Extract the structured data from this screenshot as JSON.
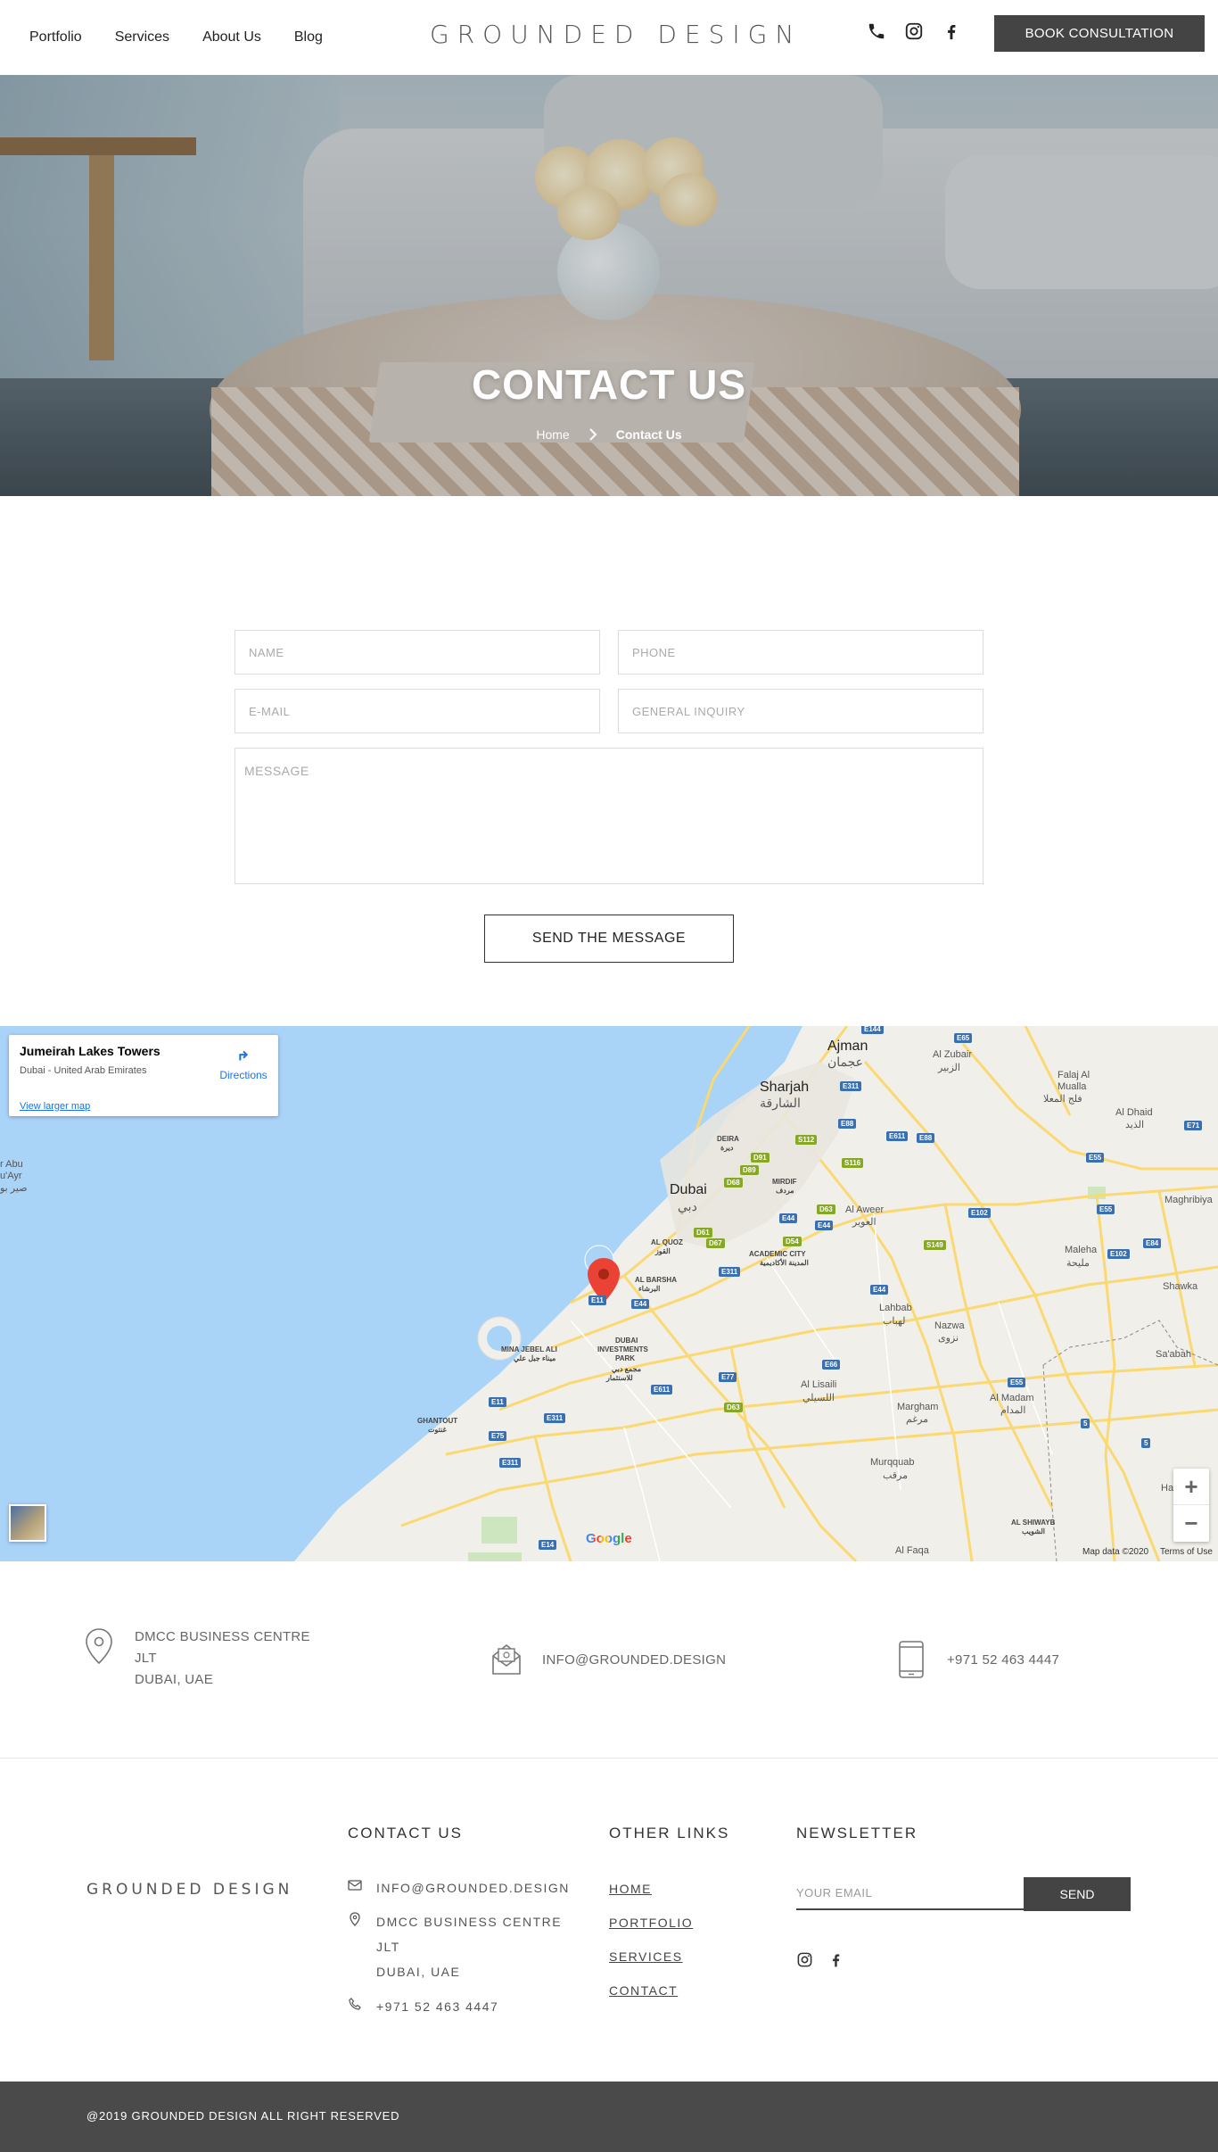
{
  "header": {
    "nav": [
      "Portfolio",
      "Services",
      "About Us",
      "Blog"
    ],
    "logo": "GROUNDED DESIGN",
    "book_label": "BOOK CONSULTATION"
  },
  "hero": {
    "title": "CONTACT US",
    "breadcrumb_home": "Home",
    "breadcrumb_current": "Contact Us"
  },
  "form": {
    "name_placeholder": "NAME",
    "phone_placeholder": "PHONE",
    "email_placeholder": "E-MAIL",
    "inquiry_placeholder": "GENERAL INQUIRY",
    "message_placeholder": "MESSAGE",
    "send_label": "SEND THE MESSAGE"
  },
  "map": {
    "place_title": "Jumeirah Lakes Towers",
    "place_sub": "Dubai - United Arab Emirates",
    "view_larger": "View larger map",
    "directions": "Directions",
    "zoom_in": "+",
    "zoom_out": "−",
    "google": "Google",
    "map_data": "Map data ©2020",
    "terms": "Terms of Use",
    "labels": {
      "ajman": "Ajman",
      "ajman_ar": "عجمان",
      "sharjah": "Sharjah",
      "sharjah_ar": "الشارقة",
      "dubai": "Dubai",
      "dubai_ar": "دبي",
      "al_zubair": "Al Zubair",
      "al_zubair_ar": "الزبير",
      "falaj": "Falaj Al",
      "falaj2": "Mualla",
      "falaj_ar": "فلج المعلا",
      "al_dhaid": "Al Dhaid",
      "al_dhaid_ar": "الذيد",
      "maghribiya": "Maghribiya",
      "maleha": "Maleha",
      "maleha_ar": "مليحة",
      "shawka": "Shawka",
      "saabah": "Sa'abah",
      "al_aweer": "Al Aweer",
      "al_aweer_ar": "العوير",
      "lahbab": "Lahbab",
      "lahbab_ar": "لهباب",
      "nazwa": "Nazwa",
      "nazwa_ar": "نزوى",
      "al_lisaili": "Al Lisaili",
      "al_lisaili_ar": "اللسيلي",
      "margham": "Margham",
      "margham_ar": "مرغم",
      "al_madam": "Al Madam",
      "al_madam_ar": "المدام",
      "murqquab": "Murqquab",
      "murqquab_ar": "مرقب",
      "al_faqa": "Al Faqa",
      "al_shiwayb": "AL SHIWAYB",
      "al_shiwayb_ar": "الشويب",
      "deira": "DEIRA",
      "deira_ar": "ديرة",
      "mirdif": "MIRDIF",
      "mirdif_ar": "مردف",
      "al_quoz": "AL QUOZ",
      "al_quoz_ar": "القوز",
      "academic_city": "ACADEMIC CITY",
      "academic_city_ar": "المدينة الأكاديمية",
      "al_barsha": "AL BARSHA",
      "al_barsha_ar": "البرشاء",
      "dubai_investments": "DUBAI",
      "dubai_investments2": "INVESTMENTS",
      "dubai_investments3": "PARK",
      "dubai_investments_ar": "مجمع دبي",
      "dubai_investments_ar2": "للاستثمار",
      "mina_jebel": "MINA JEBEL ALI",
      "mina_jebel_ar": "ميناء جبل علي",
      "ghantout": "GHANTOUT",
      "ghantout_ar": "غنتوت",
      "abu_ayr": "r Abu",
      "abu_ayr2": "u'Ayr",
      "abu_ayr_ar": "صير بو",
      "ha": "Ha"
    },
    "shields": {
      "e311a": "E311",
      "e311b": "E311",
      "e311c": "E311",
      "e311d": "E311",
      "e11a": "E11",
      "e11b": "E11",
      "e44a": "E44",
      "e44b": "E44",
      "e44c": "E44",
      "e44d": "E44",
      "e77": "E77",
      "e611a": "E611",
      "e611b": "E611",
      "e66": "E66",
      "e55a": "E55",
      "e55b": "E55",
      "e55c": "E55",
      "e102a": "E102",
      "e102b": "E102",
      "e88a": "E88",
      "e88b": "E88",
      "e84": "E84",
      "e75": "E75",
      "e14": "E14",
      "e5a": "5",
      "e5b": "5",
      "d91": "D91",
      "d89": "D89",
      "d68": "D68",
      "d63a": "D63",
      "d63b": "D63",
      "d61": "D61",
      "d67": "D67",
      "d54": "D54",
      "s112": "S112",
      "s116": "S116",
      "s149": "S149",
      "e65": "E65",
      "e71": "E71",
      "e144": "E144"
    }
  },
  "contact_strip": {
    "address": [
      "DMCC BUSINESS CENTRE",
      "JLT",
      "DUBAI, UAE"
    ],
    "email": "INFO@GROUNDED.DESIGN",
    "phone": "+971 52 463 4447"
  },
  "footer": {
    "logo": "GROUNDED DESIGN",
    "contact_heading": "CONTACT US",
    "email": "INFO@GROUNDED.DESIGN",
    "address": [
      "DMCC BUSINESS CENTRE",
      "JLT",
      "DUBAI, UAE"
    ],
    "phone": "+971 52 463 4447",
    "links_heading": "OTHER LINKS",
    "links": [
      "HOME",
      "PORTFOLIO",
      "SERVICES",
      "CONTACT"
    ],
    "newsletter_heading": "NEWSLETTER",
    "newsletter_placeholder": "YOUR EMAIL",
    "newsletter_send": "SEND",
    "copyright": "@2019 GROUNDED DESIGN ALL RIGHT RESERVED"
  },
  "colors": {
    "dark_button": "#444444",
    "bottom_bar": "#4a4a4a",
    "water": "#aad3f8",
    "land": "#f0efea",
    "road": "#fbd972",
    "pin": "#ea4335"
  }
}
